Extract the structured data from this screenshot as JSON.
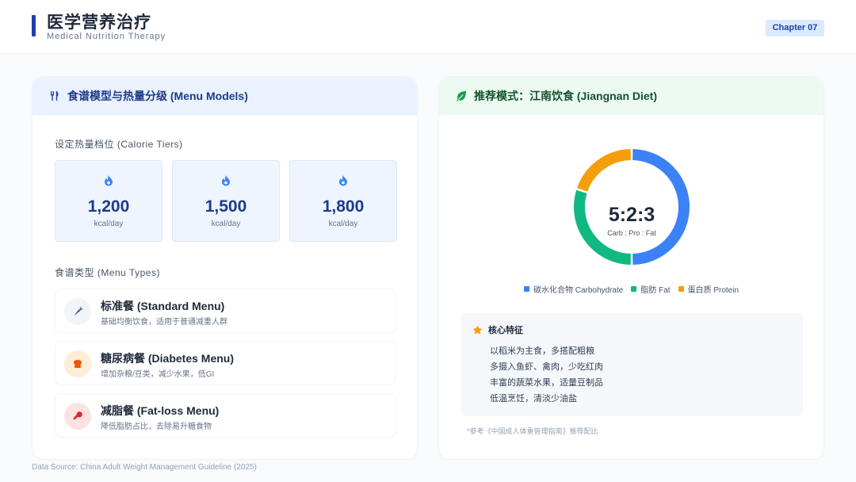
{
  "header": {
    "title": "医学营养治疗",
    "subtitle": "Medical Nutrition Therapy",
    "chapter": "Chapter 07"
  },
  "left_panel": {
    "title": "食谱模型与热量分级 (Menu Models)",
    "icon": "utensils-icon",
    "tiers_label": "设定热量档位 (Calorie Tiers)",
    "tiers": [
      {
        "value": "1,200",
        "unit": "kcal/day",
        "icon": "flame-icon"
      },
      {
        "value": "1,500",
        "unit": "kcal/day",
        "icon": "flame-icon"
      },
      {
        "value": "1,800",
        "unit": "kcal/day",
        "icon": "flame-icon"
      }
    ],
    "types_label": "食谱类型 (Menu Types)",
    "menus": [
      {
        "title": "标准餐 (Standard Menu)",
        "desc": "基础均衡饮食，适用于普通减重人群",
        "icon": "carrot-icon",
        "color": "#475569",
        "bg": "#f1f5f9"
      },
      {
        "title": "糖尿病餐 (Diabetes Menu)",
        "desc": "增加杂粮/豆类，减少水果，低GI",
        "icon": "bread-icon",
        "color": "#ea580c",
        "bg": "#ffedd5"
      },
      {
        "title": "减脂餐 (Fat-loss Menu)",
        "desc": "降低脂肪占比，去除易升糖食物",
        "icon": "drumstick-icon",
        "color": "#dc2626",
        "bg": "#fee2e2"
      }
    ]
  },
  "right_panel": {
    "title": "推荐模式：江南饮食 (Jiangnan Diet)",
    "icon": "leaf-icon",
    "ratio": "5:2:3",
    "ratio_sub": "Carb : Pro : Fat",
    "features_title": "核心特征",
    "features": [
      "以稻米为主食，多搭配粗粮",
      "多摄入鱼虾、禽肉，少吃红肉",
      "丰富的蔬菜水果，适量豆制品",
      "低温烹饪，清淡少油盐"
    ],
    "reference": "*参考《中国成人体重管理指南》推荐配比"
  },
  "chart_data": {
    "type": "pie",
    "categories": [
      "碳水化合物 Carbohydrate",
      "脂肪 Fat",
      "蛋白质 Protein"
    ],
    "values": [
      50,
      30,
      20
    ],
    "colors": [
      "#3b82f6",
      "#10b981",
      "#f59e0b"
    ]
  },
  "footer": {
    "source": "Data Source: China Adult Weight Management Guideline (2025)"
  }
}
